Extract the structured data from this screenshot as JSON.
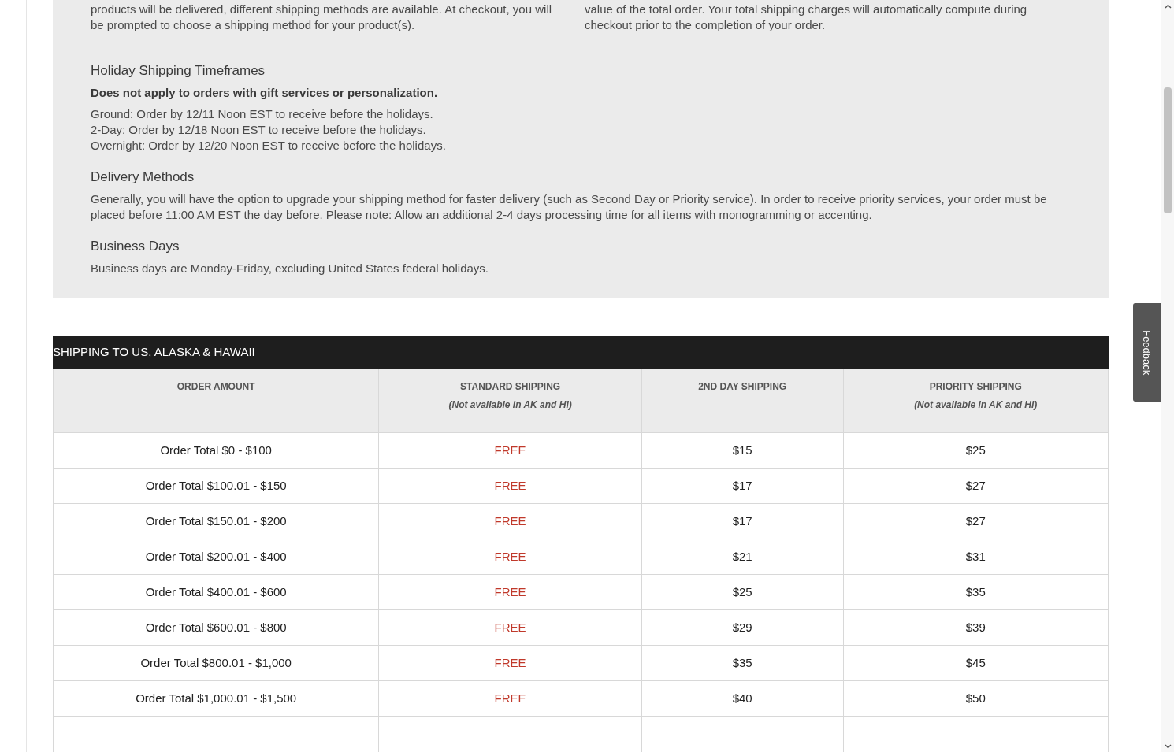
{
  "intro": {
    "columns": [
      "products will be delivered, different shipping methods are available. At checkout, you will be prompted to choose a shipping method for your product(s).",
      "value of the total order. Your total shipping charges will automatically compute during checkout prior to the completion of your order."
    ]
  },
  "sections": [
    {
      "heading": "Holiday Shipping Timeframes",
      "note": "Does not apply to orders with gift services or personalization.",
      "lines": [
        "Ground: Order by 12/11 Noon EST to receive before the holidays.",
        "2-Day: Order by 12/18 Noon EST to receive before the holidays.",
        "Overnight: Order by 12/20 Noon EST to receive before the holidays."
      ]
    },
    {
      "heading": "Delivery Methods",
      "lines": [
        "Generally, you will have the option to upgrade your shipping method for faster delivery (such as Second Day or Priority service). In order to receive priority services, your order must be placed before 11:00 AM EST the day before. Please note: Allow an additional 2-4 days processing time for all items with monogramming or accenting."
      ]
    },
    {
      "heading": "Business Days",
      "lines": [
        "Business days are Monday-Friday, excluding United States federal holidays."
      ]
    }
  ],
  "table": {
    "title": "SHIPPING TO US, ALASKA & HAWAII",
    "columns": [
      {
        "label": "ORDER AMOUNT"
      },
      {
        "label": "STANDARD SHIPPING",
        "note": "(Not available in AK and HI)"
      },
      {
        "label": "2ND DAY SHIPPING"
      },
      {
        "label": "PRIORITY SHIPPING",
        "note": "(Not available in AK and HI)"
      }
    ],
    "rows": [
      [
        "Order Total $0 - $100",
        "FREE",
        "$15",
        "$25"
      ],
      [
        "Order Total $100.01 - $150",
        "FREE",
        "$17",
        "$27"
      ],
      [
        "Order Total $150.01 - $200",
        "FREE",
        "$17",
        "$27"
      ],
      [
        "Order Total $200.01 - $400",
        "FREE",
        "$21",
        "$31"
      ],
      [
        "Order Total $400.01 - $600",
        "FREE",
        "$25",
        "$35"
      ],
      [
        "Order Total $600.01 - $800",
        "FREE",
        "$29",
        "$39"
      ],
      [
        "Order Total $800.01 - $1,000",
        "FREE",
        "$35",
        "$45"
      ],
      [
        "Order Total $1,000.01 - $1,500",
        "FREE",
        "$40",
        "$50"
      ]
    ]
  },
  "feedback_tab": {
    "label": "Feedback"
  }
}
